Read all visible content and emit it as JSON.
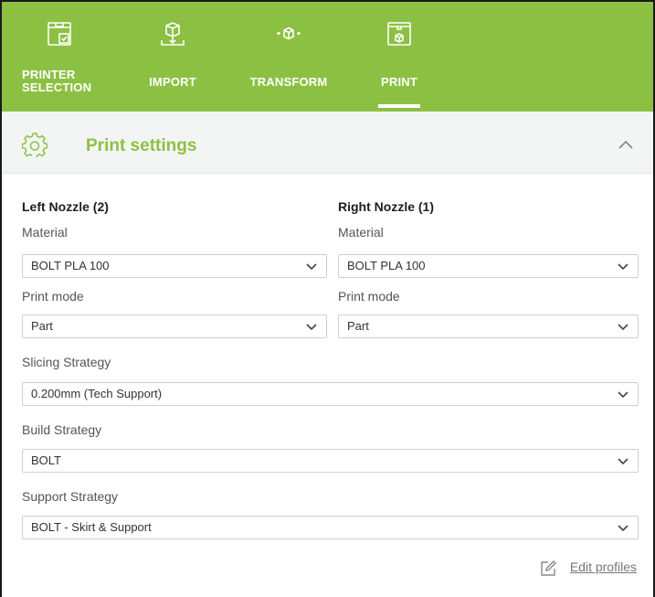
{
  "nav": {
    "items": [
      {
        "label_line1": "PRINTER",
        "label_line2": "SELECTION",
        "icon": "printer-selection-icon"
      },
      {
        "label": "IMPORT",
        "icon": "import-box-icon"
      },
      {
        "label": "TRANSFORM",
        "icon": "transform-box-icon"
      },
      {
        "label": "PRINT",
        "icon": "print-icon",
        "active": true
      }
    ]
  },
  "panel": {
    "title": "Print settings",
    "icon": "gear-icon",
    "collapse_icon": "chevron-up-icon"
  },
  "left_nozzle": {
    "heading": "Left Nozzle (2)",
    "material_label": "Material",
    "material_value": "BOLT PLA 100",
    "print_mode_label": "Print mode",
    "print_mode_value": "Part"
  },
  "right_nozzle": {
    "heading": "Right Nozzle (1)",
    "material_label": "Material",
    "material_value": "BOLT PLA 100",
    "print_mode_label": "Print mode",
    "print_mode_value": "Part"
  },
  "slicing": {
    "label": "Slicing Strategy",
    "value": "0.200mm (Tech Support)"
  },
  "build": {
    "label": "Build Strategy",
    "value": "BOLT"
  },
  "support": {
    "label": "Support Strategy",
    "value": "BOLT - Skirt & Support"
  },
  "edit_profiles": {
    "label": "Edit profiles",
    "icon": "edit-pencil-icon"
  },
  "colors": {
    "accent": "#8cc043",
    "header_bg": "#f3f4f4",
    "border": "#cfcfcf"
  }
}
